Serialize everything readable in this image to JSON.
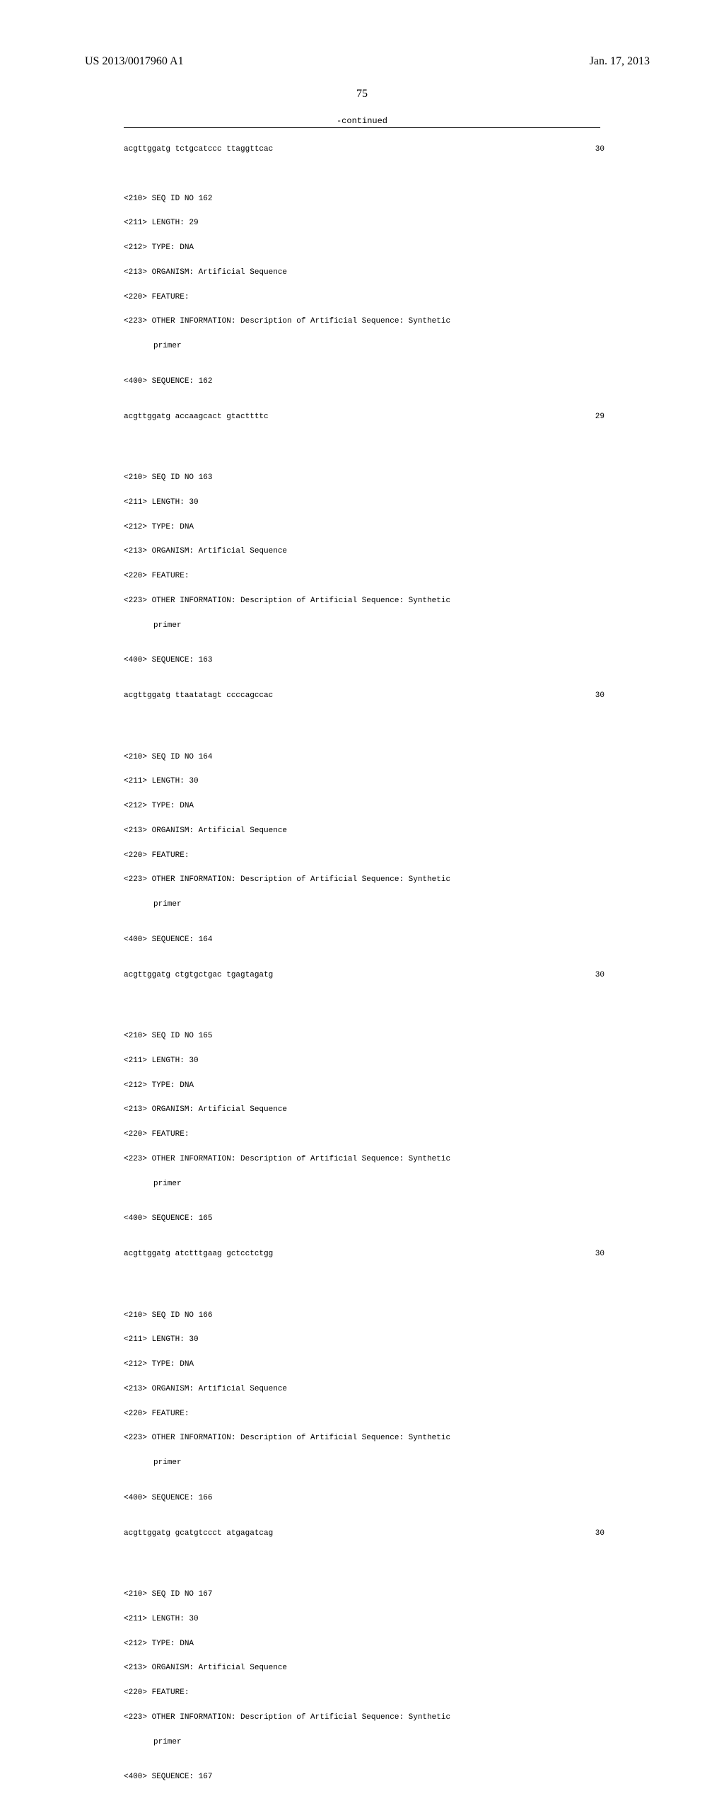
{
  "header": {
    "pub_number": "US 2013/0017960 A1",
    "pub_date": "Jan. 17, 2013"
  },
  "page_number": "75",
  "continued": "-continued",
  "top_sequence": {
    "text": "acgttggatg tctgcatccc ttaggttcac",
    "num": "30"
  },
  "entries": [
    {
      "seq_id": "<210> SEQ ID NO 162",
      "length": "<211> LENGTH: 29",
      "type": "<212> TYPE: DNA",
      "organism": "<213> ORGANISM: Artificial Sequence",
      "feature": "<220> FEATURE:",
      "other_info": "<223> OTHER INFORMATION: Description of Artificial Sequence: Synthetic",
      "primer": "primer",
      "sequence_label": "<400> SEQUENCE: 162",
      "sequence_text": "acgttggatg accaagcact gtacttttc",
      "sequence_num": "29"
    },
    {
      "seq_id": "<210> SEQ ID NO 163",
      "length": "<211> LENGTH: 30",
      "type": "<212> TYPE: DNA",
      "organism": "<213> ORGANISM: Artificial Sequence",
      "feature": "<220> FEATURE:",
      "other_info": "<223> OTHER INFORMATION: Description of Artificial Sequence: Synthetic",
      "primer": "primer",
      "sequence_label": "<400> SEQUENCE: 163",
      "sequence_text": "acgttggatg ttaatatagt ccccagccac",
      "sequence_num": "30"
    },
    {
      "seq_id": "<210> SEQ ID NO 164",
      "length": "<211> LENGTH: 30",
      "type": "<212> TYPE: DNA",
      "organism": "<213> ORGANISM: Artificial Sequence",
      "feature": "<220> FEATURE:",
      "other_info": "<223> OTHER INFORMATION: Description of Artificial Sequence: Synthetic",
      "primer": "primer",
      "sequence_label": "<400> SEQUENCE: 164",
      "sequence_text": "acgttggatg ctgtgctgac tgagtagatg",
      "sequence_num": "30"
    },
    {
      "seq_id": "<210> SEQ ID NO 165",
      "length": "<211> LENGTH: 30",
      "type": "<212> TYPE: DNA",
      "organism": "<213> ORGANISM: Artificial Sequence",
      "feature": "<220> FEATURE:",
      "other_info": "<223> OTHER INFORMATION: Description of Artificial Sequence: Synthetic",
      "primer": "primer",
      "sequence_label": "<400> SEQUENCE: 165",
      "sequence_text": "acgttggatg atctttgaag gctcctctgg",
      "sequence_num": "30"
    },
    {
      "seq_id": "<210> SEQ ID NO 166",
      "length": "<211> LENGTH: 30",
      "type": "<212> TYPE: DNA",
      "organism": "<213> ORGANISM: Artificial Sequence",
      "feature": "<220> FEATURE:",
      "other_info": "<223> OTHER INFORMATION: Description of Artificial Sequence: Synthetic",
      "primer": "primer",
      "sequence_label": "<400> SEQUENCE: 166",
      "sequence_text": "acgttggatg gcatgtccct atgagatcag",
      "sequence_num": "30"
    },
    {
      "seq_id": "<210> SEQ ID NO 167",
      "length": "<211> LENGTH: 30",
      "type": "<212> TYPE: DNA",
      "organism": "<213> ORGANISM: Artificial Sequence",
      "feature": "<220> FEATURE:",
      "other_info": "<223> OTHER INFORMATION: Description of Artificial Sequence: Synthetic",
      "primer": "primer",
      "sequence_label": "<400> SEQUENCE: 167",
      "sequence_text": "",
      "sequence_num": ""
    }
  ]
}
